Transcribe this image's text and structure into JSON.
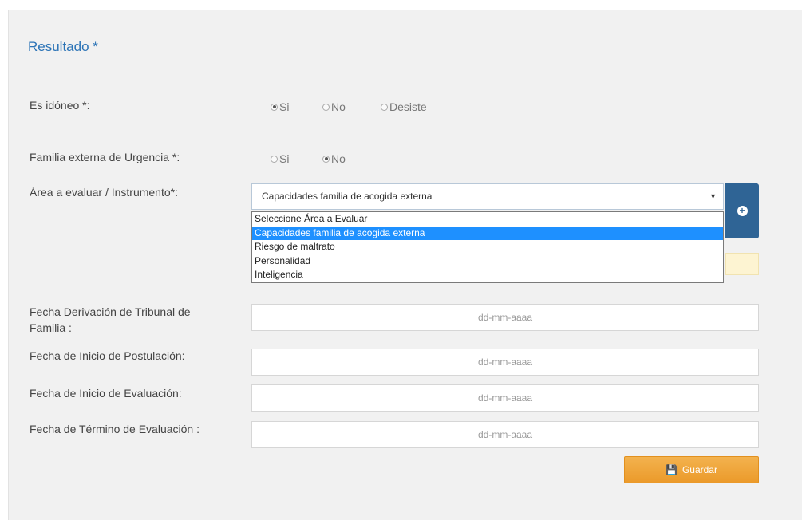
{
  "section": {
    "title": "Resultado *"
  },
  "idoneo": {
    "label": "Es idóneo *:",
    "options": [
      {
        "label": "Si",
        "checked": true
      },
      {
        "label": "No",
        "checked": false
      },
      {
        "label": "Desiste",
        "checked": false
      }
    ]
  },
  "familia_externa": {
    "label": "Familia externa de Urgencia *:",
    "options": [
      {
        "label": "Si",
        "checked": false
      },
      {
        "label": "No",
        "checked": true
      }
    ]
  },
  "area": {
    "label": "Área a evaluar / Instrumento*:",
    "selected": "Capacidades familia de acogida externa",
    "options": [
      "Seleccione Área a Evaluar",
      "Capacidades familia de acogida externa",
      "Riesgo de maltrato",
      "Personalidad",
      "Inteligencia"
    ],
    "add_icon": "plus-circle-icon"
  },
  "fecha_derivacion": {
    "label_line1": "Fecha Derivación de Tribunal de",
    "label_line2": "Familia :",
    "placeholder": "dd-mm-aaaa"
  },
  "fecha_inicio_postulacion": {
    "label": "Fecha de Inicio de Postulación:",
    "placeholder": "dd-mm-aaaa"
  },
  "fecha_inicio_evaluacion": {
    "label": "Fecha de Inicio de Evaluación:",
    "placeholder": "dd-mm-aaaa"
  },
  "fecha_termino_evaluacion": {
    "label": "Fecha de Término de Evaluación :",
    "placeholder": "dd-mm-aaaa"
  },
  "save": {
    "label": "Guardar",
    "icon": "save-icon"
  },
  "colors": {
    "title": "#2b73b6",
    "add_button": "#2f6495",
    "save_button": "#eb9a2a",
    "dropdown_highlight": "#1e90ff"
  }
}
